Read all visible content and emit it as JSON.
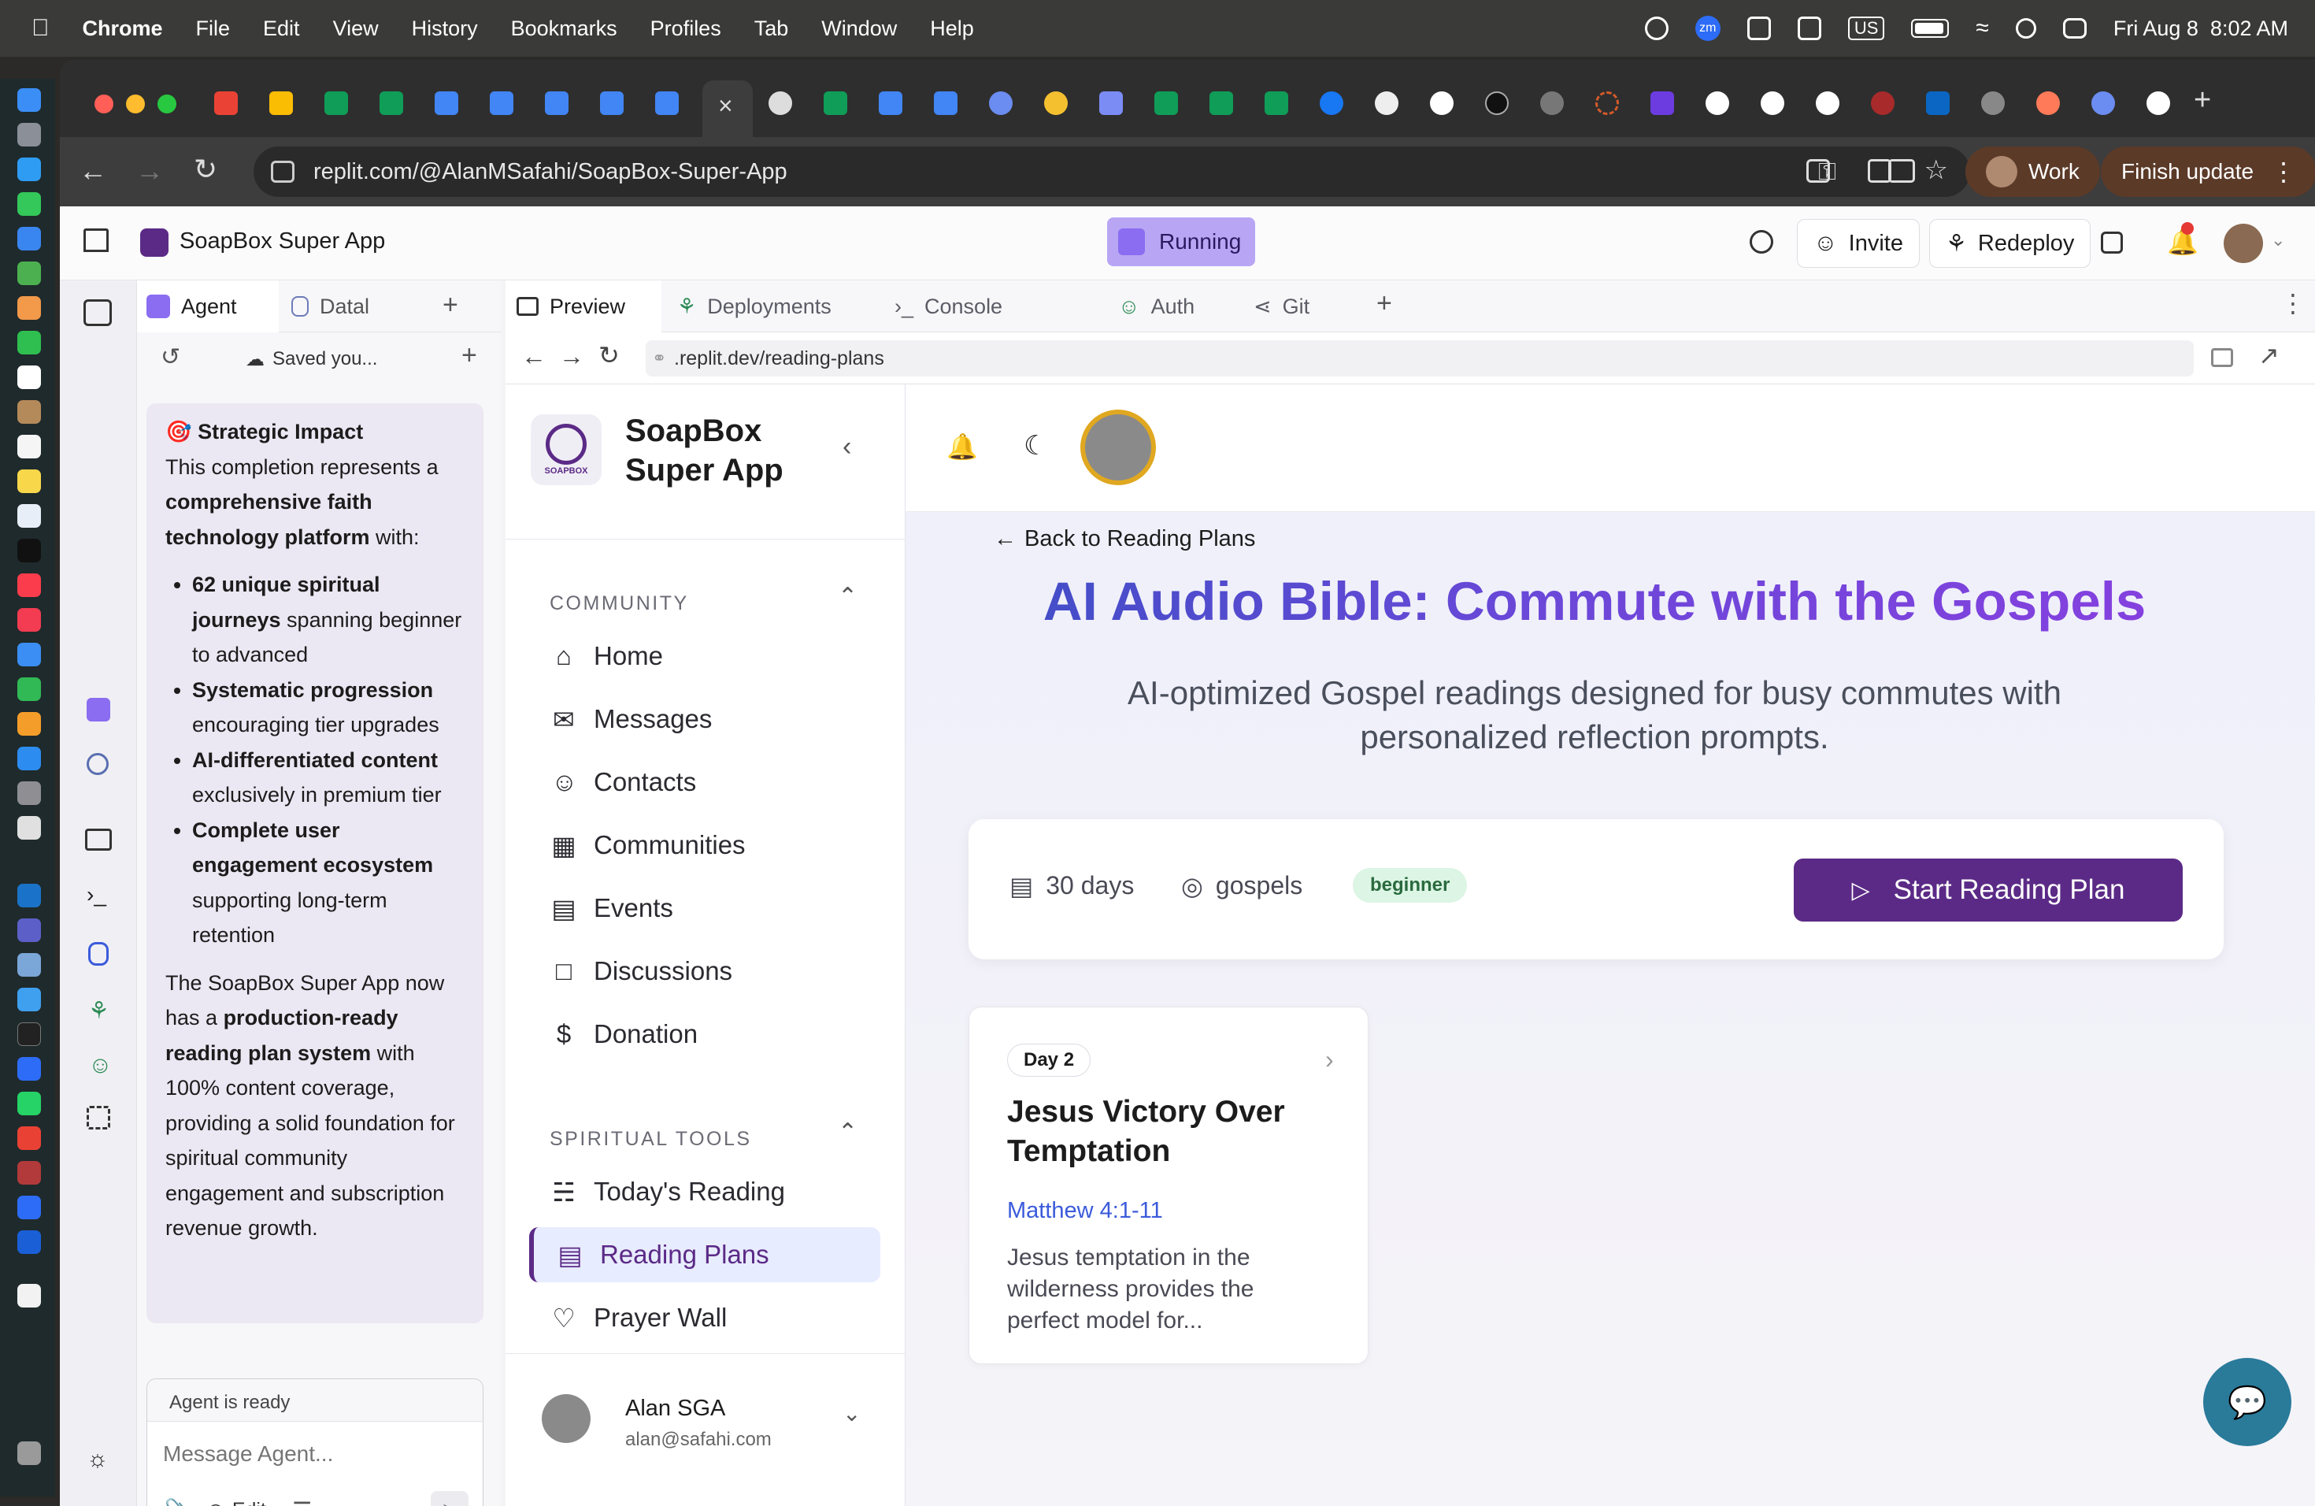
{
  "menubar": {
    "app": "Chrome",
    "menus": [
      "File",
      "Edit",
      "View",
      "History",
      "Bookmarks",
      "Profiles",
      "Tab",
      "Window",
      "Help"
    ],
    "input_source": "US",
    "clock": "Fri Aug 8  8:02 AM",
    "zoom_badge": "zm"
  },
  "browser": {
    "url": "replit.com/@AlanMSafahi/SoapBox-Super-App",
    "profile_label": "Work",
    "update_label": "Finish update"
  },
  "replit": {
    "project_name": "SoapBox Super App",
    "status": "Running",
    "invite_label": "Invite",
    "redeploy_label": "Redeploy",
    "left_tabs": [
      "Agent",
      "Datal"
    ],
    "saved_label": "Saved you...",
    "preview_tabs": [
      "Preview",
      "Deployments",
      "Console",
      "Auth",
      "Git"
    ],
    "preview_url": ".replit.dev/reading-plans"
  },
  "agent": {
    "impact_heading": "Strategic Impact",
    "intro_1": "This completion represents a ",
    "intro_bold": "comprehensive faith technology platform",
    "intro_2": " with:",
    "bullets": [
      {
        "bold": "62 unique spiritual journeys",
        "rest": " spanning beginner to advanced"
      },
      {
        "bold": "Systematic progression",
        "rest": " encouraging tier upgrades"
      },
      {
        "bold": "AI-differentiated content",
        "rest": " exclusively in premium tier"
      },
      {
        "bold": "Complete user engagement ecosystem",
        "rest": " supporting long-term retention"
      }
    ],
    "closing_1": "The SoapBox Super App now has a ",
    "closing_bold": "production-ready reading plan system",
    "closing_2": " with 100% content coverage, providing a solid foundation for spiritual community engagement and subscription revenue growth.",
    "status": "Agent is ready",
    "input_placeholder": "Message Agent...",
    "edit_label": "Edit"
  },
  "app": {
    "logo_text": "SOAPBOX",
    "brand_line1": "SoapBox",
    "brand_line2": "Super App",
    "community_heading": "COMMUNITY",
    "community_items": [
      "Home",
      "Messages",
      "Contacts",
      "Communities",
      "Events",
      "Discussions",
      "Donation"
    ],
    "tools_heading": "SPIRITUAL TOOLS",
    "tools_items": [
      "Today's Reading",
      "Reading Plans",
      "Prayer Wall"
    ],
    "user_name": "Alan SGA",
    "user_email": "alan@safahi.com"
  },
  "plan": {
    "back_label": "Back to Reading Plans",
    "title": "AI Audio Bible: Commute with the Gospels",
    "subtitle": "AI-optimized Gospel readings designed for busy commutes with personalized reflection prompts.",
    "duration": "30 days",
    "category": "gospels",
    "level": "beginner",
    "start_label": "Start Reading Plan",
    "day_badge": "Day 2",
    "day_title": "Jesus Victory Over Temptation",
    "day_ref": "Matthew 4:1-11",
    "day_excerpt": "Jesus temptation in the wilderness provides the perfect model for..."
  },
  "colors": {
    "brand_purple": "#5b2a86",
    "title_blue": "#3a4fc4",
    "title_purple": "#8a3fe0",
    "link_blue": "#3b5bdb",
    "running_bg": "#b8a6f4"
  }
}
